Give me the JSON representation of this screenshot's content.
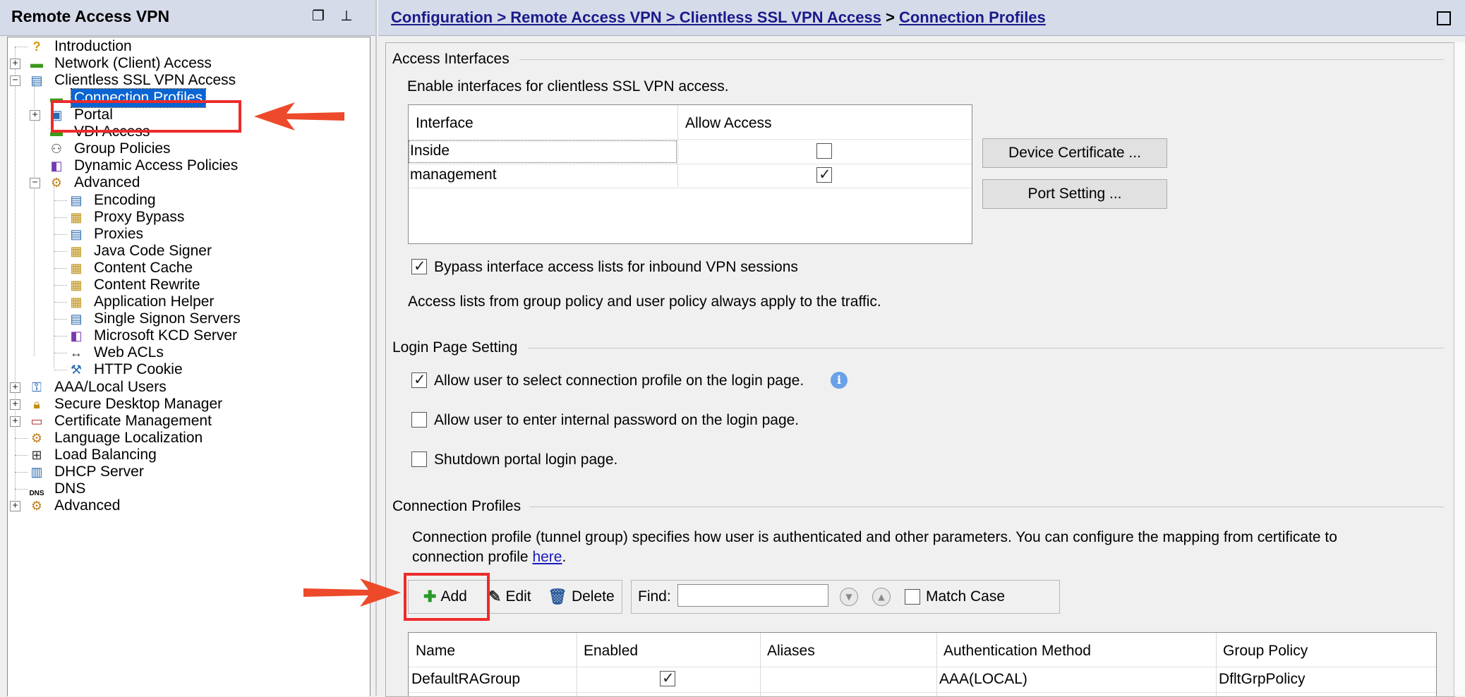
{
  "left_panel": {
    "title": "Remote Access VPN",
    "tree": [
      {
        "label": "Introduction",
        "icon": "help-icon"
      },
      {
        "label": "Network (Client) Access",
        "icon": "vpn-icon"
      },
      {
        "label": "Clientless SSL VPN Access",
        "icon": "ssl-vpn-icon"
      },
      {
        "label": "Connection Profiles",
        "icon": "connection-icon",
        "selected": true
      },
      {
        "label": "Portal",
        "icon": "portal-icon"
      },
      {
        "label": "VDI Access",
        "icon": "vdi-icon"
      },
      {
        "label": "Group Policies",
        "icon": "group-policy-icon"
      },
      {
        "label": "Dynamic Access Policies",
        "icon": "dap-icon"
      },
      {
        "label": "Advanced",
        "icon": "advanced-icon"
      },
      {
        "label": "Encoding",
        "icon": "encoding-icon"
      },
      {
        "label": "Proxy Bypass",
        "icon": "proxy-bypass-icon"
      },
      {
        "label": "Proxies",
        "icon": "proxies-icon"
      },
      {
        "label": "Java Code Signer",
        "icon": "java-signer-icon"
      },
      {
        "label": "Content Cache",
        "icon": "content-cache-icon"
      },
      {
        "label": "Content Rewrite",
        "icon": "content-rewrite-icon"
      },
      {
        "label": "Application Helper",
        "icon": "app-helper-icon"
      },
      {
        "label": "Single Signon Servers",
        "icon": "sso-icon"
      },
      {
        "label": "Microsoft KCD Server",
        "icon": "kcd-icon"
      },
      {
        "label": "Web ACLs",
        "icon": "web-acl-icon"
      },
      {
        "label": "HTTP Cookie",
        "icon": "cookie-icon"
      },
      {
        "label": "AAA/Local Users",
        "icon": "aaa-icon"
      },
      {
        "label": "Secure Desktop Manager",
        "icon": "lock-icon"
      },
      {
        "label": "Certificate Management",
        "icon": "certificate-icon"
      },
      {
        "label": "Language Localization",
        "icon": "language-icon"
      },
      {
        "label": "Load Balancing",
        "icon": "load-balancing-icon"
      },
      {
        "label": "DHCP Server",
        "icon": "dhcp-icon"
      },
      {
        "label": "DNS",
        "icon": "dns-icon",
        "icon_text": "DNS"
      },
      {
        "label": "Advanced",
        "icon": "advanced-icon"
      }
    ]
  },
  "breadcrumb": {
    "part1": "Configuration",
    "sep": " > ",
    "part2": "Remote Access VPN",
    "part3": "Clientless SSL VPN Access",
    "part4": "Connection Profiles"
  },
  "access_interfaces": {
    "title": "Access Interfaces",
    "description": "Enable interfaces for clientless SSL VPN access.",
    "columns": [
      "Interface",
      "Allow Access"
    ],
    "rows": [
      {
        "interface": "Inside",
        "allow": false
      },
      {
        "interface": "management",
        "allow": true
      }
    ],
    "device_certificate_button": "Device Certificate ...",
    "port_setting_button": "Port Setting ...",
    "bypass_label": "Bypass interface access lists for inbound VPN sessions",
    "bypass_checked": true,
    "note": "Access lists from group policy and user policy always apply to the traffic."
  },
  "login_page": {
    "title": "Login Page Setting",
    "opt1": "Allow user to select connection profile on the login page.",
    "opt1_checked": true,
    "opt2": "Allow user to enter internal password on the login page.",
    "opt2_checked": false,
    "opt3": "Shutdown portal login page.",
    "opt3_checked": false
  },
  "connection_profiles": {
    "title": "Connection Profiles",
    "description_line1": "Connection profile (tunnel group) specifies how user is authenticated and other parameters. You can configure the mapping from certificate to",
    "description_line2": "connection profile",
    "link": "here",
    "period": ".",
    "toolbar": {
      "add": "Add",
      "edit": "Edit",
      "delete": "Delete",
      "find_label": "Find:",
      "find_value": "",
      "match_case": "Match Case"
    },
    "columns": [
      "Name",
      "Enabled",
      "Aliases",
      "Authentication Method",
      "Group Policy"
    ],
    "rows": [
      {
        "name": "DefaultRAGroup",
        "enabled": true,
        "aliases": "",
        "auth": "AAA(LOCAL)",
        "policy": "DfltGrpPolicy"
      }
    ]
  },
  "colors": {
    "highlight_red": "#ec2b2b",
    "selection_blue": "#0a64d2",
    "header_bg": "#d6dbe9",
    "link_blue": "#1a1a8c"
  }
}
